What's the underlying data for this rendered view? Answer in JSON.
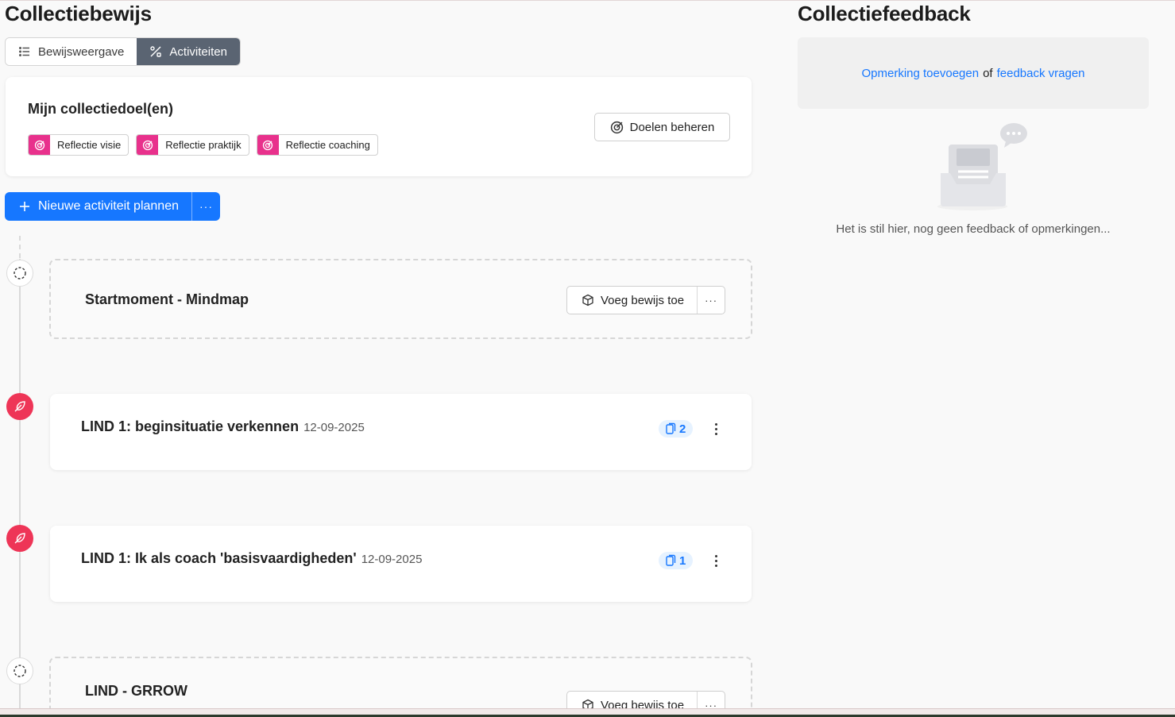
{
  "left": {
    "title": "Collectiebewijs",
    "tabs": [
      {
        "label": "Bewijsweergave",
        "icon": "list-icon",
        "active": false
      },
      {
        "label": "Activiteiten",
        "icon": "percent-tools-icon",
        "active": true
      }
    ],
    "goals": {
      "title": "Mijn collectiedoel(en)",
      "chips": [
        "Reflectie visie",
        "Reflectie praktijk",
        "Reflectie coaching"
      ],
      "manage_label": "Doelen beheren"
    },
    "new_activity": {
      "label": "Nieuwe activiteit plannen",
      "more": "···"
    },
    "activities": [
      {
        "title": "Startmoment - Mindmap",
        "button": "Voeg bewijs toe",
        "more": "···"
      },
      {
        "title": "LIND 1: beginsituatie verkennen",
        "date": "12-09-2025",
        "count": "2"
      },
      {
        "title": "LIND 1: Ik als coach 'basisvaardigheden'",
        "date": "12-09-2025",
        "count": "1"
      },
      {
        "title": "LIND - GRROW",
        "button": "Voeg bewijs toe",
        "more": "···"
      }
    ]
  },
  "right": {
    "title": "Collectiefeedback",
    "add_comment": "Opmerking toevoegen",
    "or": "of",
    "ask_feedback": "feedback vragen",
    "empty": "Het is stil hier, nog geen feedback of opmerkingen..."
  },
  "colors": {
    "primary": "#1677ff",
    "goal_pink": "#e8318c",
    "node_red": "#ee3557",
    "tab_active": "#5a6472"
  }
}
